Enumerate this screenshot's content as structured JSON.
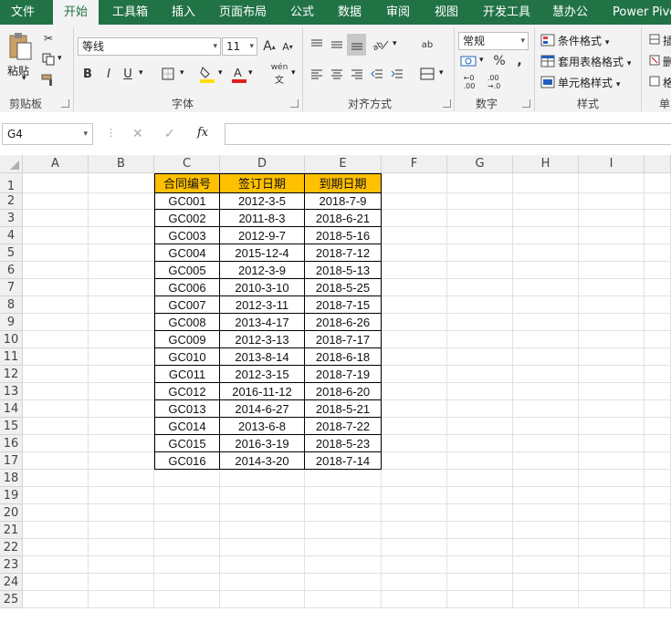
{
  "ribbon_tabs": [
    "文件",
    "开始",
    "工具箱",
    "插入",
    "页面布局",
    "公式",
    "数据",
    "审阅",
    "视图",
    "开发工具",
    "慧办公",
    "Power Pivo"
  ],
  "active_tab": "开始",
  "clipboard": {
    "paste_label": "粘贴",
    "group_label": "剪贴板"
  },
  "font": {
    "name": "等线",
    "size": "11",
    "group_label": "字体",
    "bold": "B",
    "italic": "I",
    "underline": "U",
    "grow": "A",
    "shrink": "A",
    "phonetic": "wén"
  },
  "alignment": {
    "group_label": "对齐方式"
  },
  "number": {
    "format": "常规",
    "group_label": "数字",
    "percent": "%",
    "comma": ","
  },
  "styles": {
    "conditional": "条件格式",
    "table_format": "套用表格格式",
    "cell_style": "单元格样式",
    "group_label": "样式"
  },
  "cells_group": {
    "insert": "插",
    "delete": "删",
    "format": "格",
    "group_label": "单"
  },
  "formula_bar": {
    "name_box": "G4",
    "fx": "fx",
    "cancel": "✕",
    "enter": "✓",
    "value": ""
  },
  "columns": [
    "A",
    "B",
    "C",
    "D",
    "E",
    "F",
    "G",
    "H",
    "I"
  ],
  "rows": [
    "1",
    "2",
    "3",
    "4",
    "5",
    "6",
    "7",
    "8",
    "9",
    "10",
    "11",
    "12",
    "13",
    "14",
    "15",
    "16",
    "17",
    "18",
    "19",
    "20",
    "21",
    "22",
    "23",
    "24",
    "25"
  ],
  "table": {
    "headers": [
      "合同编号",
      "签订日期",
      "到期日期"
    ],
    "rows": [
      [
        "GC001",
        "2012-3-5",
        "2018-7-9"
      ],
      [
        "GC002",
        "2011-8-3",
        "2018-6-21"
      ],
      [
        "GC003",
        "2012-9-7",
        "2018-5-16"
      ],
      [
        "GC004",
        "2015-12-4",
        "2018-7-12"
      ],
      [
        "GC005",
        "2012-3-9",
        "2018-5-13"
      ],
      [
        "GC006",
        "2010-3-10",
        "2018-5-25"
      ],
      [
        "GC007",
        "2012-3-11",
        "2018-7-15"
      ],
      [
        "GC008",
        "2013-4-17",
        "2018-6-26"
      ],
      [
        "GC009",
        "2012-3-13",
        "2018-7-17"
      ],
      [
        "GC010",
        "2013-8-14",
        "2018-6-18"
      ],
      [
        "GC011",
        "2012-3-15",
        "2018-7-19"
      ],
      [
        "GC012",
        "2016-11-12",
        "2018-6-20"
      ],
      [
        "GC013",
        "2014-6-27",
        "2018-5-21"
      ],
      [
        "GC014",
        "2013-6-8",
        "2018-7-22"
      ],
      [
        "GC015",
        "2016-3-19",
        "2018-5-23"
      ],
      [
        "GC016",
        "2014-3-20",
        "2018-7-14"
      ]
    ]
  },
  "colors": {
    "brand": "#217346",
    "header_fill": "#ffc000",
    "font_color_bar": "#e02020",
    "fill_color_bar": "#ffe000"
  }
}
